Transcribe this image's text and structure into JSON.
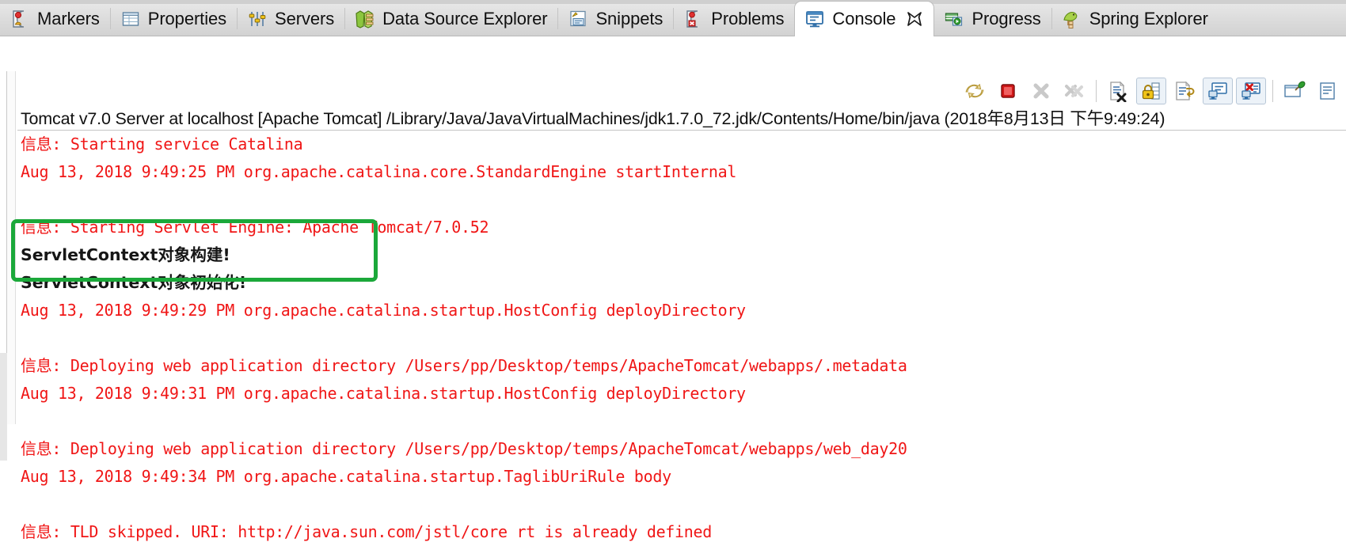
{
  "window": {
    "app": "Eclipse IDE",
    "active_view": "Console"
  },
  "tabs": [
    {
      "label": "Markers",
      "icon": "markers-icon",
      "active": false
    },
    {
      "label": "Properties",
      "icon": "properties-icon",
      "active": false
    },
    {
      "label": "Servers",
      "icon": "servers-icon",
      "active": false
    },
    {
      "label": "Data Source Explorer",
      "icon": "data-source-explorer-icon",
      "active": false
    },
    {
      "label": "Snippets",
      "icon": "snippets-icon",
      "active": false
    },
    {
      "label": "Problems",
      "icon": "problems-icon",
      "active": false
    },
    {
      "label": "Console",
      "icon": "console-icon",
      "active": true
    },
    {
      "label": "Progress",
      "icon": "progress-icon",
      "active": false
    },
    {
      "label": "Spring Explorer",
      "icon": "spring-explorer-icon",
      "active": false
    }
  ],
  "toolbar": {
    "buttons": [
      {
        "name": "relaunch-icon",
        "tooltip": "Relaunch",
        "enabled": true
      },
      {
        "name": "terminate-icon",
        "tooltip": "Terminate",
        "enabled": true
      },
      {
        "name": "remove-launch-icon",
        "tooltip": "Remove Launch",
        "enabled": false
      },
      {
        "name": "remove-all-terminated-icon",
        "tooltip": "Remove All Terminated Launches",
        "enabled": false
      },
      {
        "name": "clear-console-icon",
        "tooltip": "Clear Console",
        "enabled": true
      },
      {
        "name": "scroll-lock-icon",
        "tooltip": "Scroll Lock",
        "enabled": true
      },
      {
        "name": "word-wrap-icon",
        "tooltip": "Word Wrap",
        "enabled": true
      },
      {
        "name": "show-console-icon",
        "tooltip": "Display Selected Console",
        "enabled": true
      },
      {
        "name": "open-console-icon",
        "tooltip": "Open Console",
        "enabled": true
      },
      {
        "name": "pin-console-icon",
        "tooltip": "Pin Console",
        "enabled": true
      },
      {
        "name": "new-console-view-icon",
        "tooltip": "New Console View",
        "enabled": true
      }
    ]
  },
  "console": {
    "header": "Tomcat v7.0 Server at localhost [Apache Tomcat] /Library/Java/JavaVirtualMachines/jdk1.7.0_72.jdk/Contents/Home/bin/java (2018年8月13日 下午9:49:24)",
    "lines": [
      {
        "text": "信息: Starting service Catalina",
        "color": "red"
      },
      {
        "text": "Aug 13, 2018 9:49:25 PM org.apache.catalina.core.StandardEngine startInternal",
        "color": "red"
      },
      {
        "text": "",
        "color": "red"
      },
      {
        "text": "信息: Starting Servlet Engine: Apache Tomcat/7.0.52",
        "color": "red"
      },
      {
        "text": "ServletContext对象构建!",
        "color": "black"
      },
      {
        "text": "ServletContext对象初始化!",
        "color": "black"
      },
      {
        "text": "Aug 13, 2018 9:49:29 PM org.apache.catalina.startup.HostConfig deployDirectory",
        "color": "red"
      },
      {
        "text": "",
        "color": "red"
      },
      {
        "text": "信息: Deploying web application directory /Users/pp/Desktop/temps/ApacheTomcat/webapps/.metadata",
        "color": "red"
      },
      {
        "text": "Aug 13, 2018 9:49:31 PM org.apache.catalina.startup.HostConfig deployDirectory",
        "color": "red"
      },
      {
        "text": "",
        "color": "red"
      },
      {
        "text": "信息: Deploying web application directory /Users/pp/Desktop/temps/ApacheTomcat/webapps/web_day20",
        "color": "red"
      },
      {
        "text": "Aug 13, 2018 9:49:34 PM org.apache.catalina.startup.TaglibUriRule body",
        "color": "red"
      },
      {
        "text": "",
        "color": "red"
      },
      {
        "text": "信息: TLD skipped. URI: http://java.sun.com/jstl/core rt is already defined",
        "color": "red"
      }
    ],
    "highlight": {
      "name": "green-annotation-box",
      "color": "#1ba83a",
      "covers": [
        "ServletContext对象构建!",
        "ServletContext对象初始化!"
      ]
    }
  },
  "colors": {
    "log_red": "#f01616",
    "log_black": "#161616",
    "annotation_green": "#1ba83a",
    "tabbar_bg": "#dcdcdc",
    "content_bg": "#ffffff"
  }
}
